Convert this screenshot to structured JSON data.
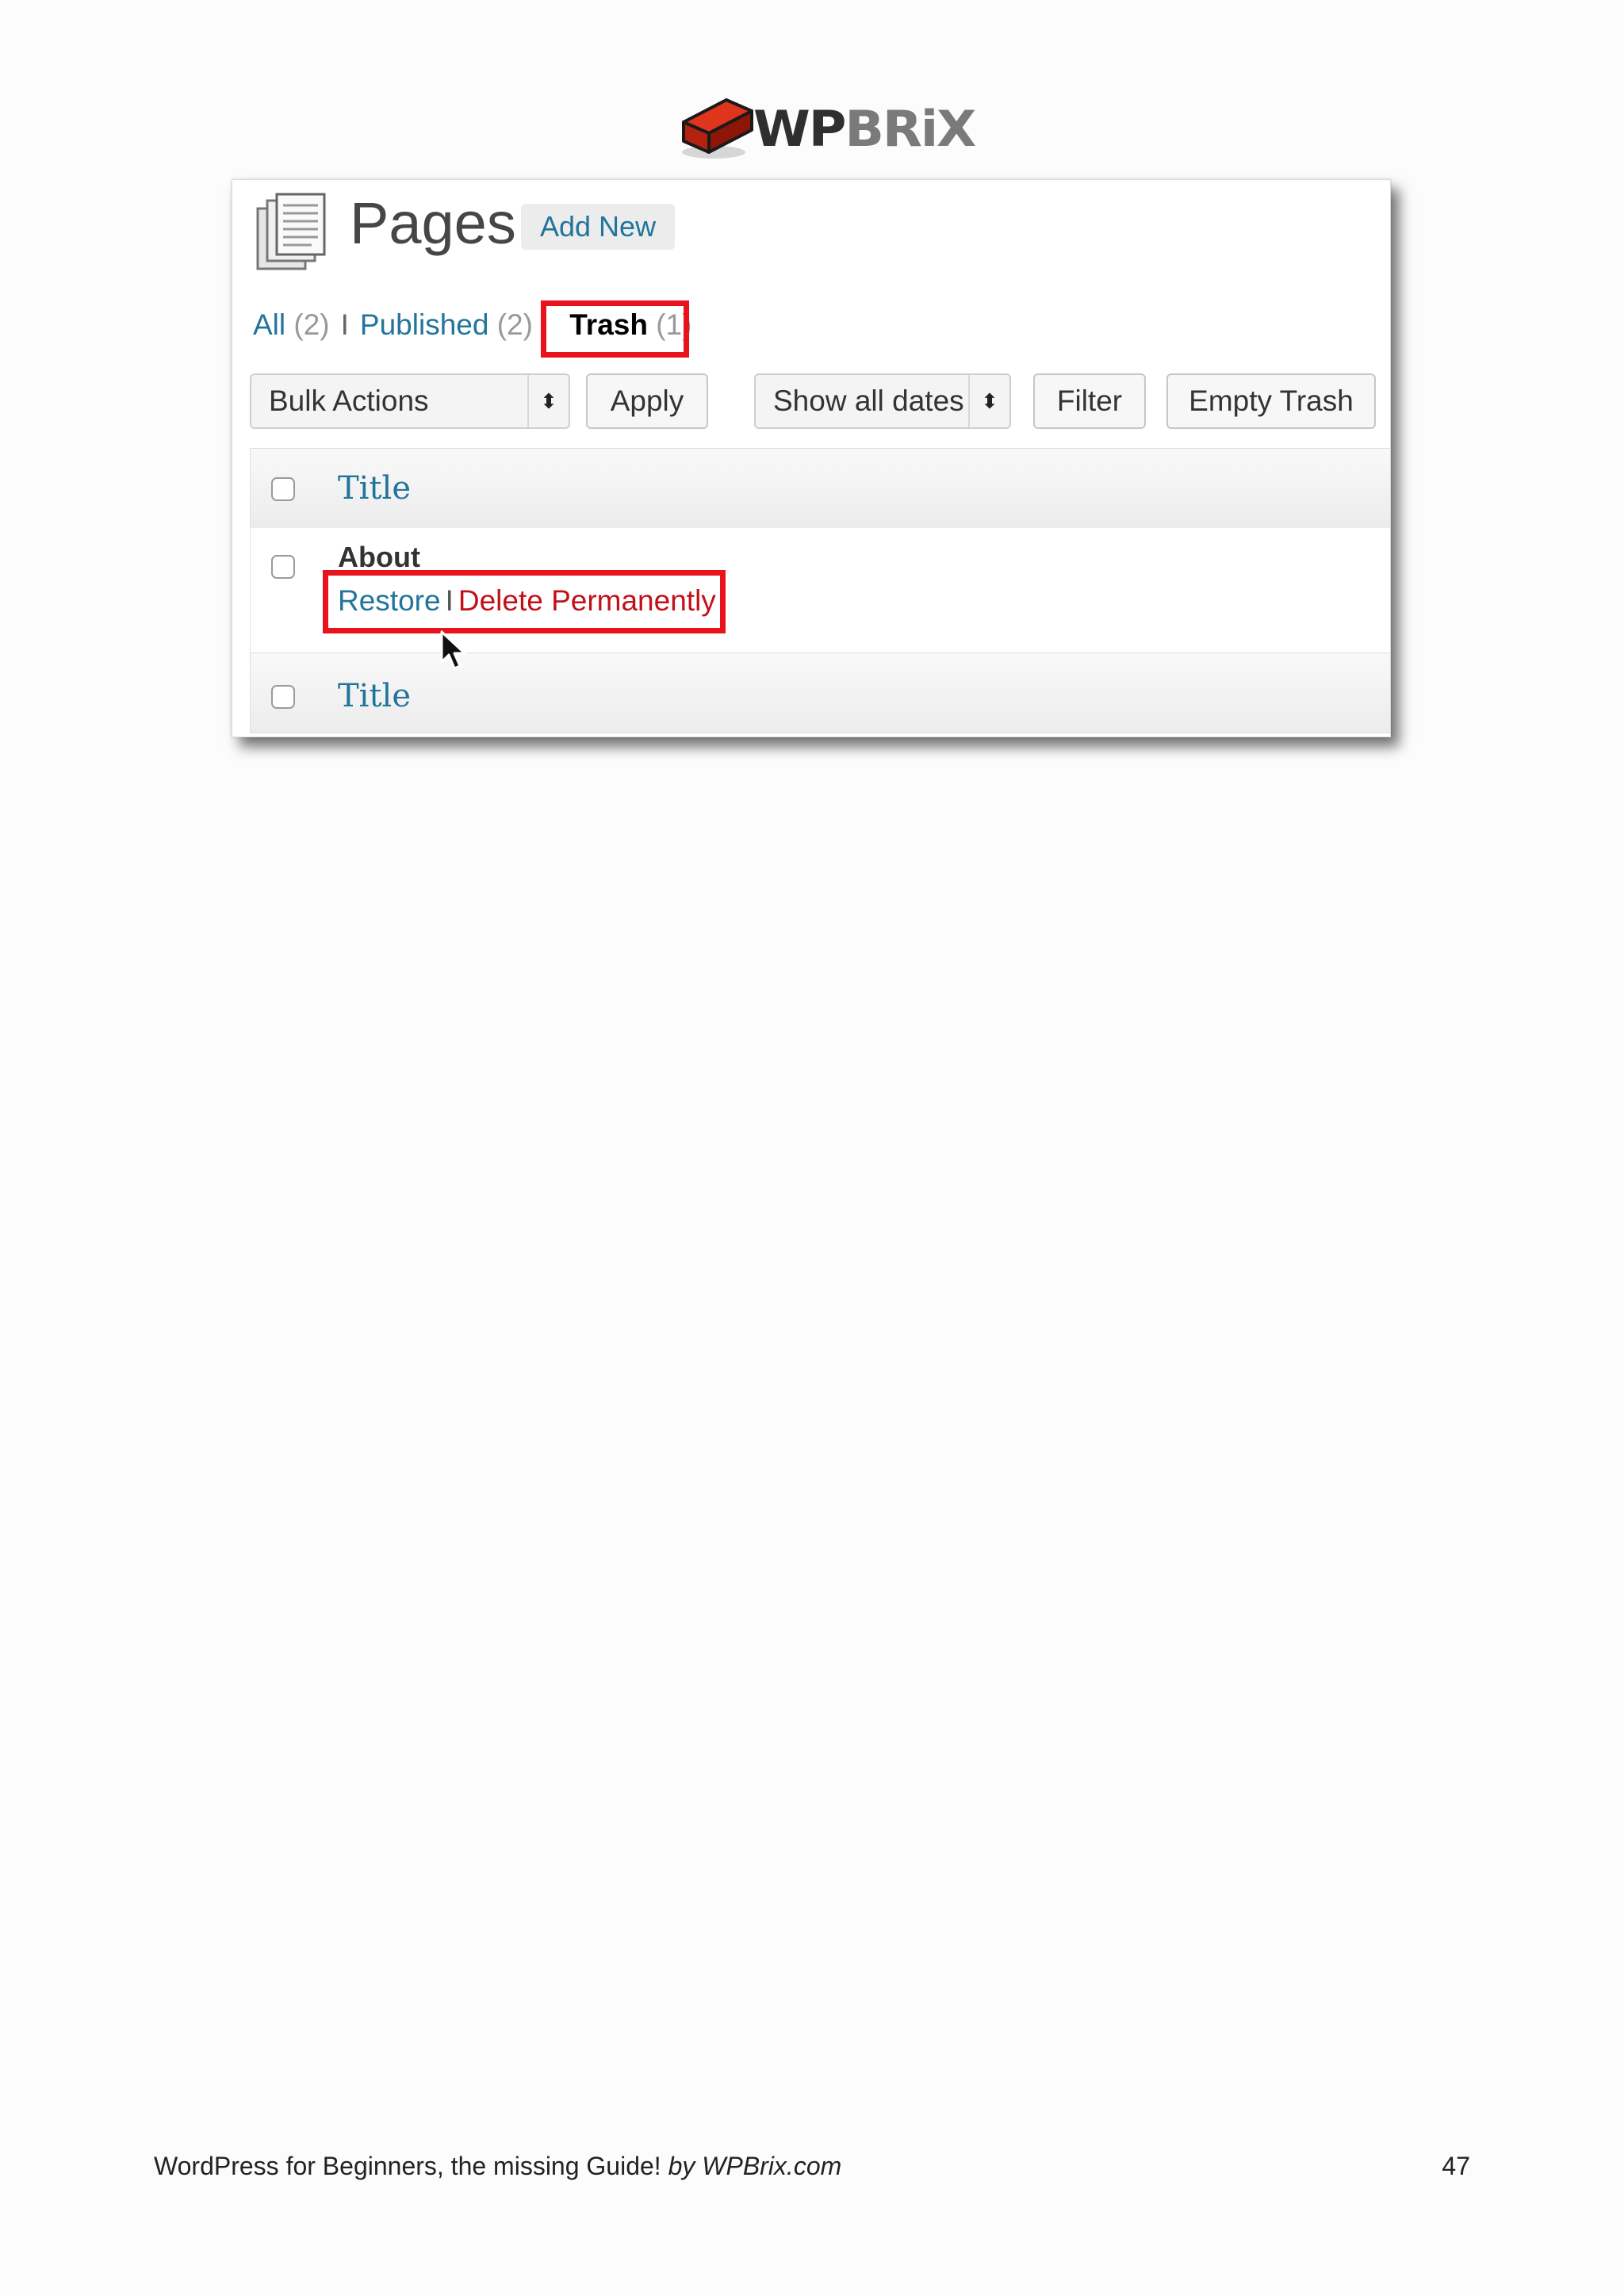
{
  "logo": {
    "text_a": "WP",
    "text_b": "B",
    "text_c": "RiX"
  },
  "screen": {
    "title": "Pages",
    "add_new": "Add New",
    "filters": {
      "all_label": "All",
      "all_count": "(2)",
      "separator": "I",
      "published_label": "Published",
      "published_count": "(2)",
      "trash_label": "Trash",
      "trash_count": "(1)"
    },
    "bulk_actions": {
      "selected": "Bulk Actions",
      "arrows": "⬍"
    },
    "apply": "Apply",
    "dates": {
      "selected": "Show all dates",
      "arrows": "⬍"
    },
    "filter": "Filter",
    "empty_trash": "Empty Trash",
    "table": {
      "header_title": "Title",
      "footer_title": "Title",
      "rows": [
        {
          "title": "About",
          "restore": "Restore",
          "separator": "I",
          "delete": "Delete Permanently"
        }
      ]
    }
  },
  "highlight_color": "#e8131c",
  "link_color": "#21759b",
  "footer": {
    "book": "WordPress for Beginners, the missing Guide!",
    "by": "by WPBrix.com",
    "page": "47"
  }
}
